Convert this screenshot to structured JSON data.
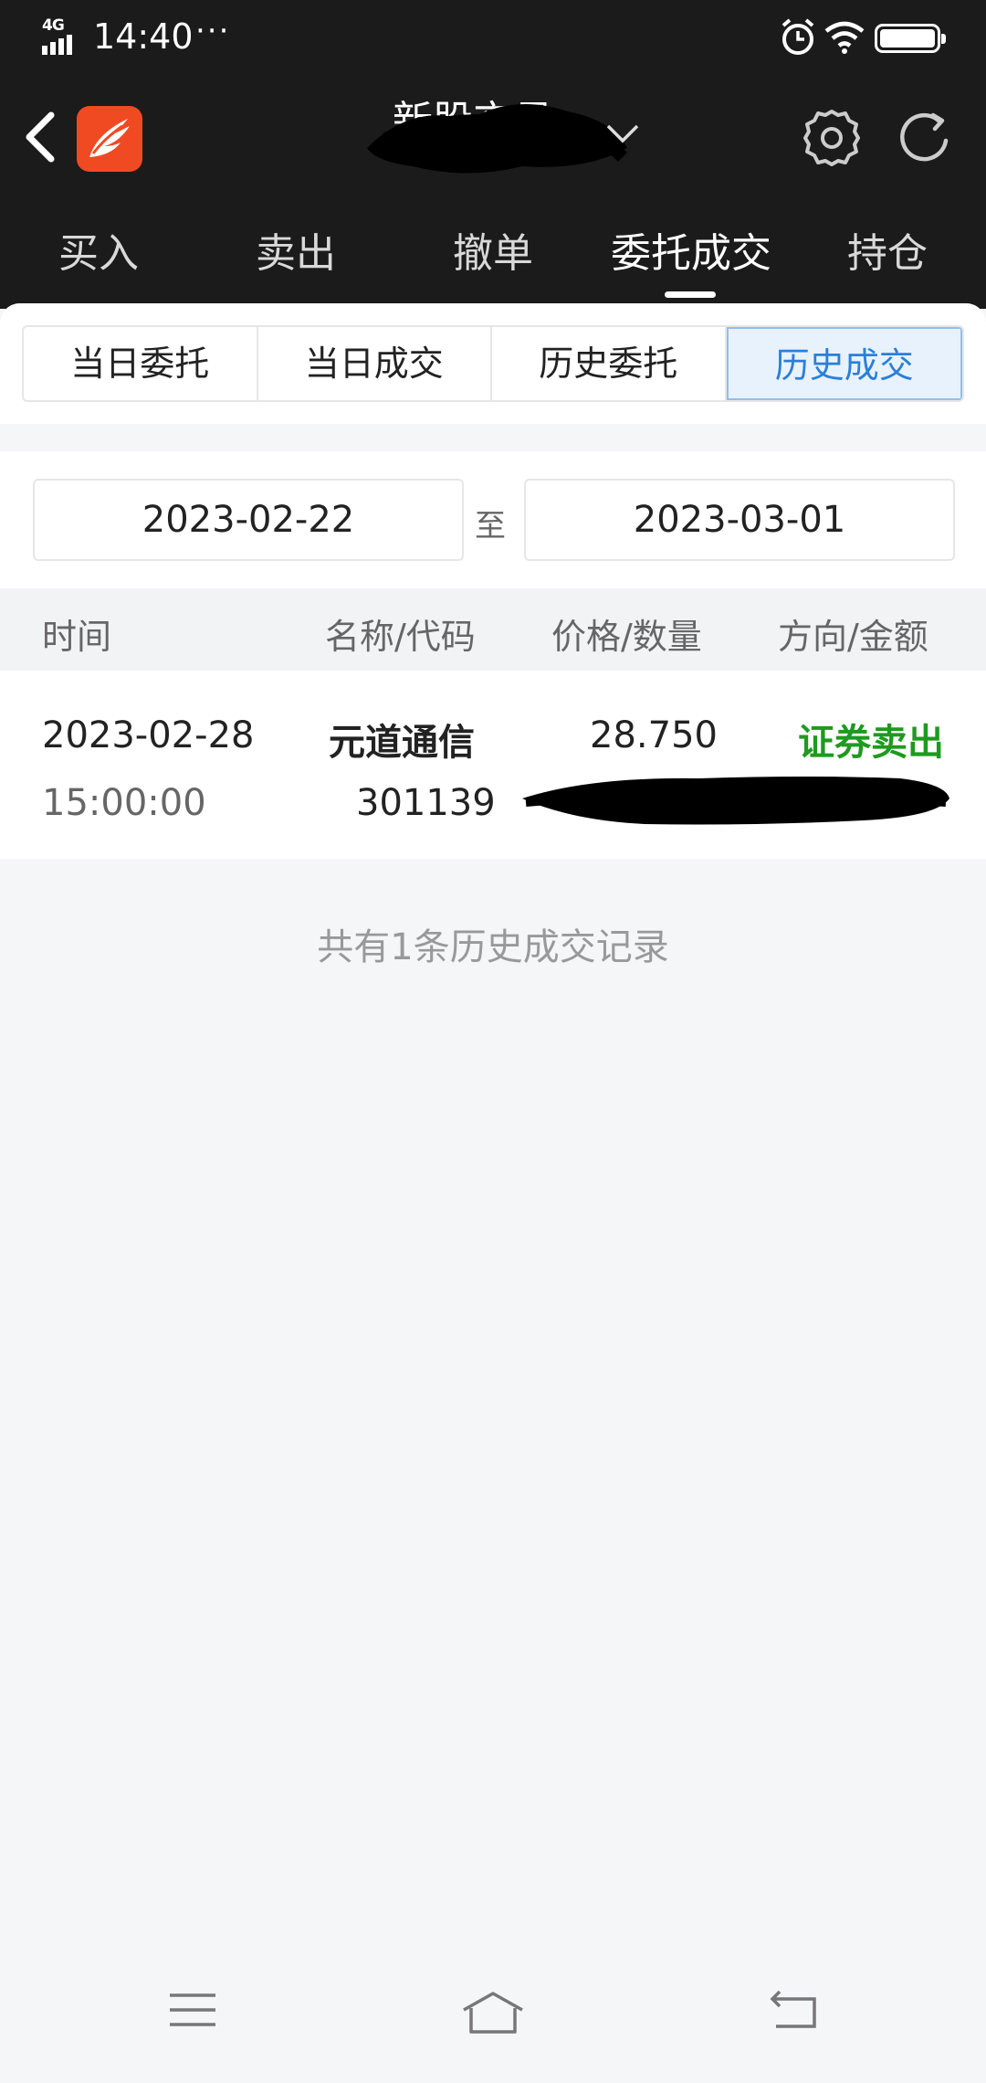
{
  "status_bar": {
    "network": "4G",
    "time": "14:40",
    "dots": "···"
  },
  "header": {
    "title": "新股交易"
  },
  "tabs": [
    {
      "label": "买入"
    },
    {
      "label": "卖出"
    },
    {
      "label": "撤单"
    },
    {
      "label": "委托成交",
      "active": true
    },
    {
      "label": "持仓"
    }
  ],
  "segments": [
    {
      "label": "当日委托"
    },
    {
      "label": "当日成交"
    },
    {
      "label": "历史委托"
    },
    {
      "label": "历史成交",
      "active": true
    }
  ],
  "date_range": {
    "start": "2023-02-22",
    "separator": "至",
    "end": "2023-03-01"
  },
  "table": {
    "headers": {
      "time": "时间",
      "name_code": "名称/代码",
      "price_qty": "价格/数量",
      "dir_amount": "方向/金额"
    },
    "rows": [
      {
        "date": "2023-02-28",
        "clock": "15:00:00",
        "name": "元道通信",
        "code": "301139",
        "price": "28.750",
        "direction": "证券卖出"
      }
    ]
  },
  "summary": "共有1条历史成交记录",
  "colors": {
    "top_bg": "#1b1b1b",
    "accent": "#2b7fd9",
    "sell": "#1e9a1e",
    "logo": "#f04a23"
  },
  "icons": [
    "back-icon",
    "app-logo-icon",
    "chevron-down-icon",
    "gear-icon",
    "refresh-icon",
    "menu-icon",
    "home-icon",
    "return-icon"
  ]
}
